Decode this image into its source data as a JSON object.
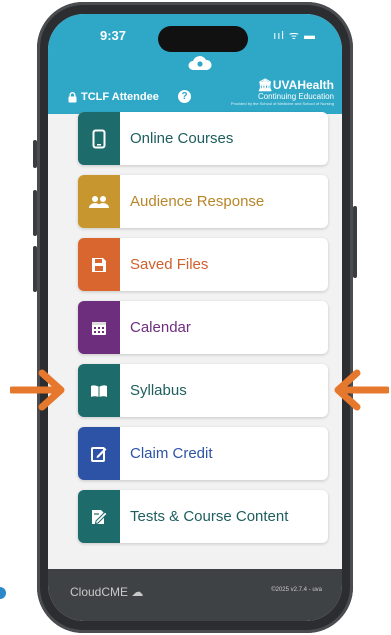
{
  "status": {
    "time": "9:37",
    "icons": "ııl ᯤ ▬"
  },
  "header": {
    "attendee": "TCLF Attendee",
    "help": "?",
    "brand_main": "UVAHealth",
    "brand_sub": "Continuing Education",
    "brand_tag": "Provided by the School of Medicine and School of Nursing"
  },
  "menu": [
    {
      "label": "Online Courses",
      "color": "#1e6b6b",
      "text_color": "#1e5e5e",
      "icon": "phone-icon"
    },
    {
      "label": "Audience Response",
      "color": "#c8962e",
      "text_color": "#b8862a",
      "icon": "people-icon"
    },
    {
      "label": "Saved Files",
      "color": "#d9652f",
      "text_color": "#d0602d",
      "icon": "save-icon"
    },
    {
      "label": "Calendar",
      "color": "#6d2f7d",
      "text_color": "#6d2f7d",
      "icon": "calendar-icon"
    },
    {
      "label": "Syllabus",
      "color": "#1e6b6b",
      "text_color": "#1e5e5e",
      "icon": "book-icon"
    },
    {
      "label": "Claim Credit",
      "color": "#2c53a6",
      "text_color": "#2c53a6",
      "icon": "pencil-icon"
    },
    {
      "label": "Tests & Course Content",
      "color": "#1e6b6b",
      "text_color": "#1e5e5e",
      "icon": "test-icon"
    }
  ],
  "footer": {
    "left": "CloudCME",
    "right": "©2025 v2.7.4 - uva"
  },
  "colors": {
    "header": "#2fa8c8",
    "arrow": "#e6782d"
  }
}
